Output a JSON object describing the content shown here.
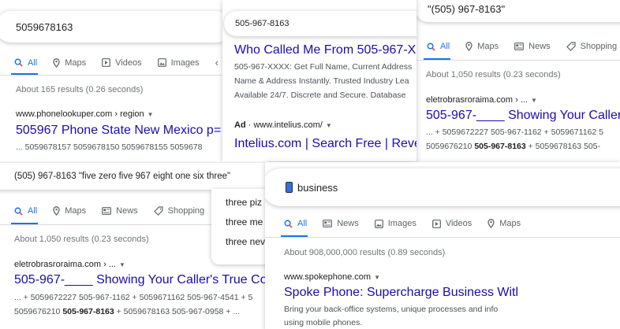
{
  "panel1": {
    "query": "5059678163",
    "tabs": [
      "All",
      "Maps",
      "Videos",
      "Images"
    ],
    "stats": "About 165 results (0.26 seconds)",
    "result": {
      "cite": "www.phonelookuper.com › region",
      "title": "505967 Phone State New Mexico p=",
      "snippet": "... 5059678157 5059678150 5059678155 5059678"
    }
  },
  "panel2": {
    "query": "505-967-8163",
    "result1": {
      "title": "Who Called Me From 505-967-XX",
      "snippet_lines": [
        "505-967-XXXX: Get Full Name, Current Address",
        "Name & Address Instantly. Trusted Industry Lea",
        "Available 24/7. Discrete and Secure. Database"
      ]
    },
    "ad": {
      "label": "Ad",
      "sep": " · ",
      "cite": "www.intelius.com/",
      "title": "Intelius.com | Search Free | Reve"
    }
  },
  "panel3": {
    "query": "\"(505) 967-8163\"",
    "tabs": [
      "All",
      "Maps",
      "News",
      "Shopping"
    ],
    "stats": "About 1,050 results (0.23 seconds)",
    "result": {
      "cite": "eletrobrasroraima.com › ...",
      "title": "505-967-____ Showing Your Caller",
      "line1": "... + 5059672227 505-967-1162 + 5059671162 5",
      "line2_pre": "5059676210 ",
      "line2_bold": "505-967-8163",
      "line2_post": " + 5059678163 505-"
    }
  },
  "panel4": {
    "query": "(505) 967-8163 \"five zero five 967 eight one six three\"",
    "tabs": [
      "All",
      "Maps",
      "News",
      "Shopping"
    ],
    "stats": "About 1,050 results (0.23 seconds)",
    "result": {
      "cite": "eletrobrasroraima.com › ...",
      "title": "505-967-____ Showing Your Caller's True Colc",
      "line1": "... + 5059672227 505-967-1162 + 5059671162 505-967-4541 + 5",
      "line2_pre": "5059676210 ",
      "line2_bold": "505-967-8163",
      "line2_post": " + 5059678163 505-967-0958 + ..."
    }
  },
  "suggestions": {
    "items": [
      "three piz",
      "three me",
      "three nev"
    ]
  },
  "panel5": {
    "query": "business",
    "tabs": [
      "All",
      "News",
      "Images",
      "Videos",
      "Maps"
    ],
    "stats": "About 908,000,000 results (0.89 seconds)",
    "result": {
      "cite": "www.spokephone.com",
      "title": "Spoke Phone: Supercharge Business Witl",
      "snippet_lines": [
        "Bring your back-office systems, unique processes and info",
        "using mobile phones."
      ]
    }
  },
  "colors": {
    "link": "#1a0dab",
    "accent": "#1a73e8",
    "meta": "#70757a",
    "snippet": "#4d5156"
  }
}
